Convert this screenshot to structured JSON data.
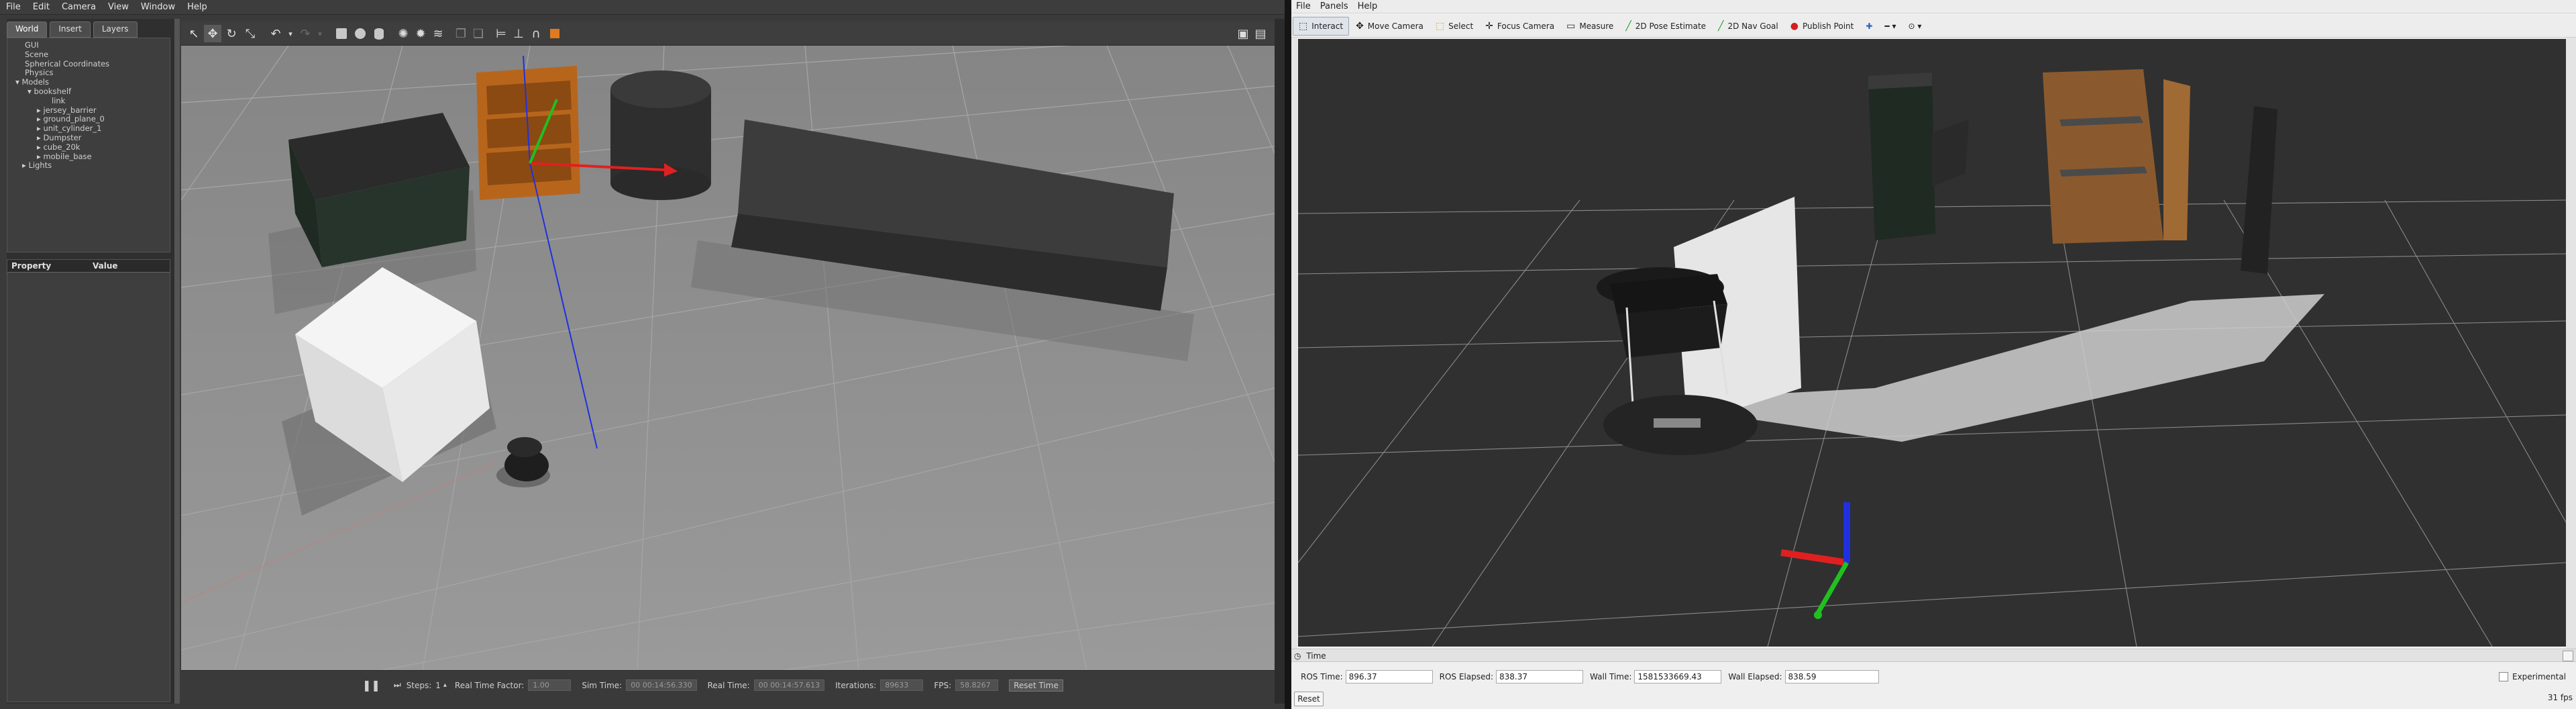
{
  "gazebo": {
    "menu": [
      "File",
      "Edit",
      "Camera",
      "View",
      "Window",
      "Help"
    ],
    "tabs": [
      "World",
      "Insert",
      "Layers"
    ],
    "tree": {
      "items": [
        "GUI",
        "Scene",
        "Spherical Coordinates",
        "Physics",
        "Models",
        "bookshelf",
        "link",
        "jersey_barrier",
        "ground_plane_0",
        "unit_cylinder_1",
        "Dumpster",
        "cube_20k",
        "mobile_base",
        "Lights"
      ]
    },
    "properties": {
      "col_property": "Property",
      "col_value": "Value"
    },
    "bottom": {
      "steps_label": "Steps:",
      "steps_value": "1",
      "rtf_label": "Real Time Factor:",
      "rtf_value": "1.00",
      "sim_label": "Sim Time:",
      "sim_value": "00 00:14:56.330",
      "real_label": "Real Time:",
      "real_value": "00 00:14:57.613",
      "iter_label": "Iterations:",
      "iter_value": "89633",
      "fps_label": "FPS:",
      "fps_value": "58.8267",
      "reset_label": "Reset Time"
    }
  },
  "rviz": {
    "menu": [
      "File",
      "Panels",
      "Help"
    ],
    "tools": [
      "Interact",
      "Move Camera",
      "Select",
      "Focus Camera",
      "Measure",
      "2D Pose Estimate",
      "2D Nav Goal",
      "Publish Point"
    ],
    "time_panel": {
      "title": "Time",
      "ros_time_label": "ROS Time:",
      "ros_time": "896.37",
      "ros_elapsed_label": "ROS Elapsed:",
      "ros_elapsed": "838.37",
      "wall_time_label": "Wall Time:",
      "wall_time": "1581533669.43",
      "wall_elapsed_label": "Wall Elapsed:",
      "wall_elapsed": "838.59",
      "experimental": "Experimental",
      "reset": "Reset",
      "fps": "31 fps"
    }
  },
  "colors": {
    "gazebo_bg": "#3a3a3a",
    "rviz_bg": "#303030",
    "axis_x": "#e02020",
    "axis_y": "#20c020",
    "axis_z": "#2030e0"
  }
}
